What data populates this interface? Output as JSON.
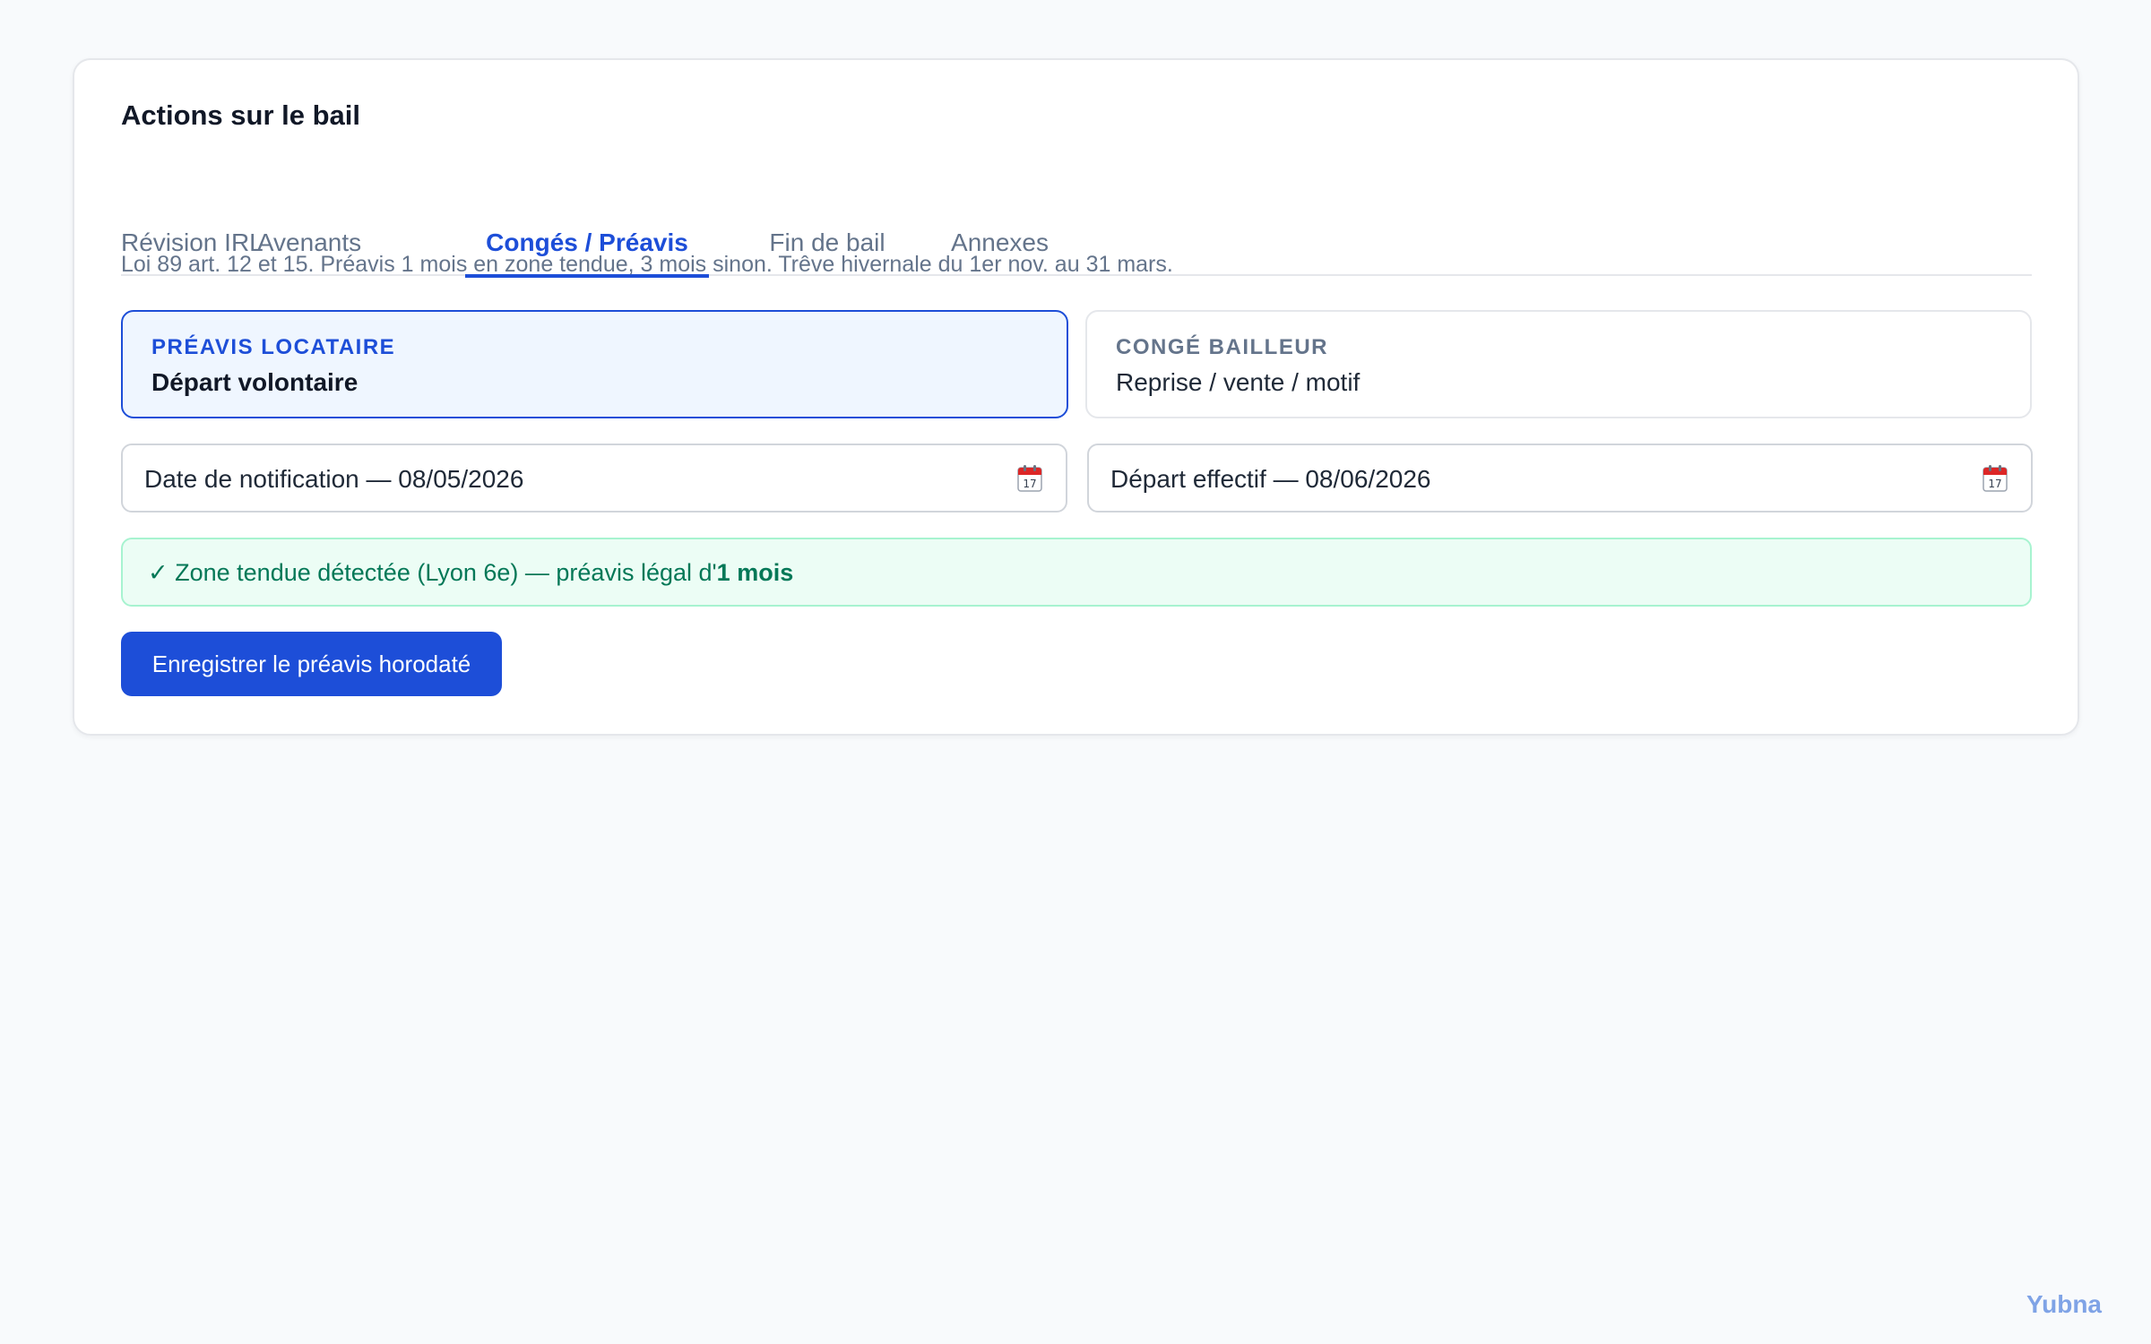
{
  "card": {
    "title": "Actions sur le bail",
    "tabs": [
      {
        "label": "Révision IRL",
        "active": false
      },
      {
        "label": "Avenants",
        "active": false
      },
      {
        "label": "Congés / Préavis",
        "active": true
      },
      {
        "label": "Fin de bail",
        "active": false
      },
      {
        "label": "Annexes",
        "active": false
      }
    ],
    "notice": "Loi 89 art. 12 et 15. Préavis 1 mois en zone tendue, 3 mois sinon. Trêve hivernale du 1er nov. au 31 mars.",
    "options": [
      {
        "kicker": "Préavis locataire",
        "label": "Départ volontaire",
        "selected": true
      },
      {
        "kicker": "Congé bailleur",
        "label": "Reprise / vente / motif",
        "selected": false
      }
    ],
    "date_fields": [
      {
        "value": "Date de notification — 08/05/2026",
        "icon": "calendar-icon"
      },
      {
        "value": "Départ effectif — 08/06/2026",
        "icon": "calendar-icon"
      }
    ],
    "alert": {
      "prefix": "✓ Zone tendue détectée (Lyon 6e) — préavis légal d'",
      "emphasis": "1 mois"
    },
    "submit_label": "Enregistrer le préavis horodaté"
  },
  "brand": "Yubna",
  "colors": {
    "accent": "#1d4ed8",
    "success_bg": "#ecfdf5",
    "success_text": "#047857",
    "muted": "#64748b"
  }
}
